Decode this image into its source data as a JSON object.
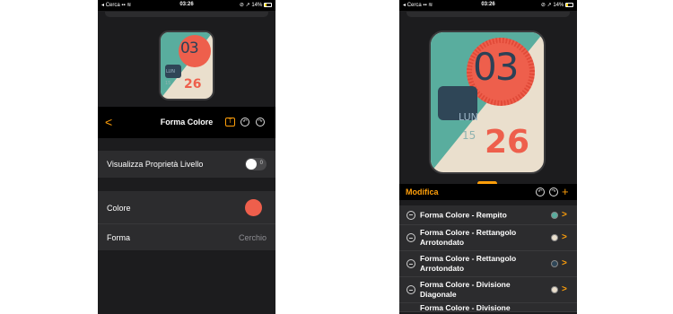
{
  "status": {
    "carrier": "Cerca",
    "time": "03:26",
    "battery": "14%"
  },
  "watch": {
    "hour": "03",
    "minute": "26",
    "day": "LUN",
    "date": "15"
  },
  "left": {
    "title": "Forma Colore",
    "back": "<",
    "visualizza_label": "Visualizza Proprietà Livello",
    "toggle_value": "0",
    "colore_label": "Colore",
    "colore_value": "#ee5f4c",
    "forma_label": "Forma",
    "forma_value": "Cerchio"
  },
  "right": {
    "modifica_label": "Modifica",
    "add_label": "+",
    "items": [
      {
        "label": "Forma Colore - Rempito",
        "color": "#59ad9e"
      },
      {
        "label": "Forma Colore - Rettangolo Arrotondato",
        "color": "#eadfcd"
      },
      {
        "label": "Forma Colore - Rettangolo Arrotondato",
        "color": "#2f4657"
      },
      {
        "label": "Forma Colore - Divisione Diagonale",
        "color": "#eadfcd"
      },
      {
        "label": "Forma Colore - Divisione"
      }
    ]
  }
}
